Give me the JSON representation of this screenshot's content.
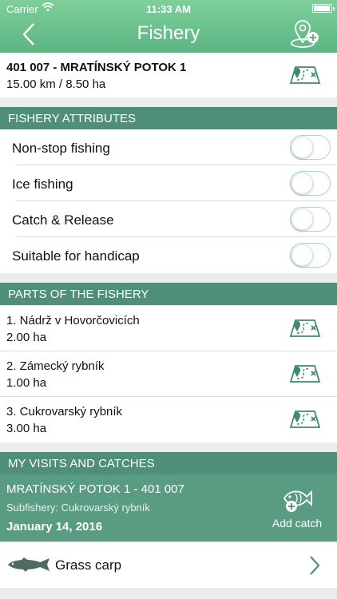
{
  "status_bar": {
    "carrier": "Carrier",
    "time": "11:33 AM"
  },
  "nav": {
    "title": "Fishery",
    "back_icon": "chevron-left-icon",
    "action_icon": "map-pin-add-icon"
  },
  "fishery": {
    "name": "401 007 - MRATÍNSKÝ POTOK 1",
    "size": "15.00 km / 8.50 ha"
  },
  "attributes": {
    "header": "FISHERY ATTRIBUTES",
    "items": [
      {
        "label": "Non-stop fishing",
        "enabled": false
      },
      {
        "label": "Ice fishing",
        "enabled": false
      },
      {
        "label": "Catch & Release",
        "enabled": false
      },
      {
        "label": "Suitable for handicap",
        "enabled": false
      }
    ]
  },
  "parts": {
    "header": "PARTS OF THE FISHERY",
    "items": [
      {
        "name": "1. Nádrž v Hovorčovicích",
        "area": "2.00 ha"
      },
      {
        "name": "2. Zámecký rybník",
        "area": "1.00 ha"
      },
      {
        "name": "3. Cukrovarský rybník",
        "area": "3.00 ha"
      }
    ]
  },
  "visits": {
    "header": "MY VISITS AND CATCHES",
    "visit": {
      "title": "MRATÍNSKÝ POTOK 1 - 401 007",
      "subfishery": "Subfishery: Cukrovarský rybník",
      "date": "January 14, 2016",
      "add_catch_label": "Add catch"
    },
    "catches": [
      {
        "name": "Grass carp",
        "icon": "fish-icon"
      }
    ]
  },
  "colors": {
    "header_green": "#6cc28e",
    "section_header": "#4f8f7a",
    "visit_card": "#5a9c82",
    "icon_green": "#3f8a6d"
  }
}
